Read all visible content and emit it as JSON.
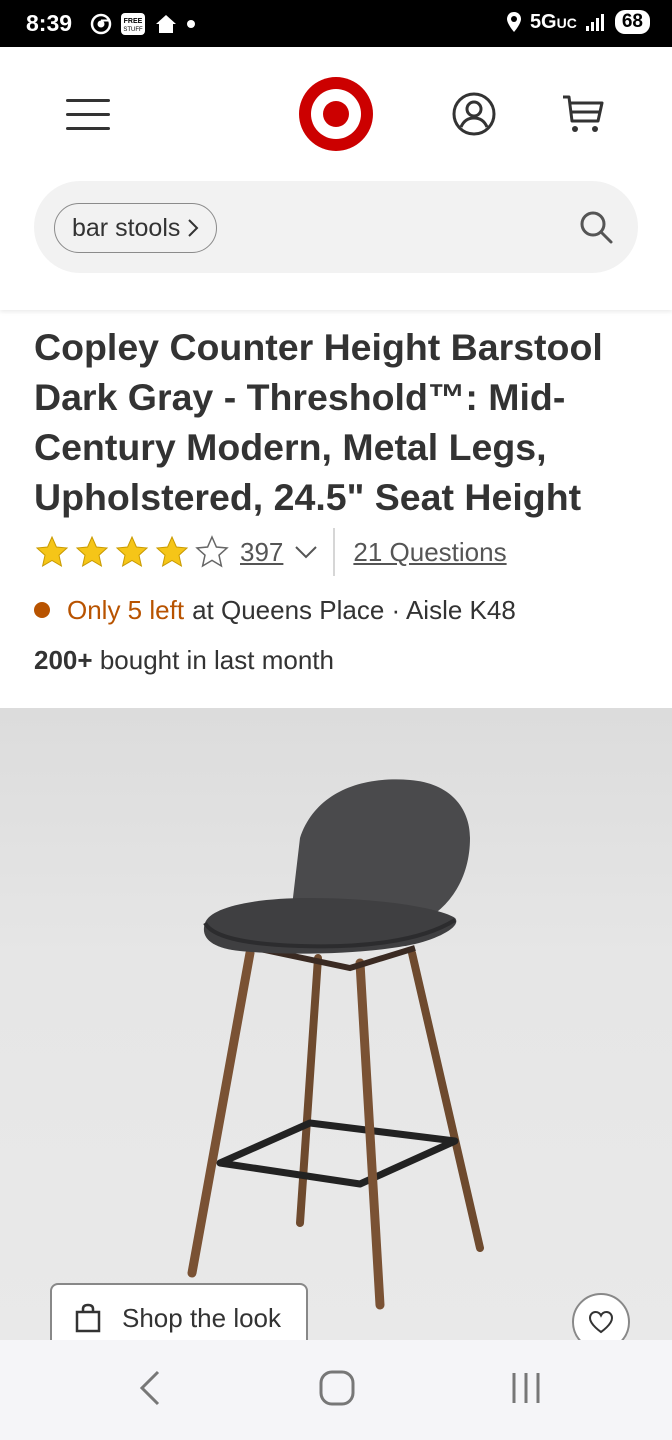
{
  "status_bar": {
    "time": "8:39",
    "network": "5G",
    "network_suffix": "UC",
    "battery": "68",
    "free_stuff_icon_text": "FREE STUFF"
  },
  "header": {
    "menu_icon": "hamburger-menu-icon",
    "logo": "target-bullseye-logo",
    "account_icon": "account-icon",
    "cart_icon": "cart-icon",
    "brand_color": "#cc0000"
  },
  "search": {
    "chip_label": "bar stools",
    "chip_icon": "chevron-right-icon",
    "search_icon": "search-icon"
  },
  "product": {
    "title": "Copley Counter Height Barstool Dark Gray - Threshold™: Mid-Century Modern, Metal Legs, Upholstered, 24.5\" Seat Height",
    "rating": {
      "stars_filled": 4,
      "stars_total": 5,
      "review_count": "397",
      "questions_label": "21 Questions",
      "star_color": "#f5c518"
    },
    "stock": {
      "low_label": "Only 5 left",
      "location_label": "at Queens Place · Aisle K48",
      "status_color": "#b85300"
    },
    "bought": {
      "count": "200+",
      "label": "bought in last month"
    },
    "image": {
      "alt": "Dark gray upholstered counter height barstool with walnut finish metal legs"
    },
    "shop_the_look_label": "Shop the look",
    "favorite_icon": "heart-icon"
  },
  "nav_bar": {
    "back_icon": "back-icon",
    "home_icon": "home-icon",
    "recents_icon": "recents-icon"
  }
}
